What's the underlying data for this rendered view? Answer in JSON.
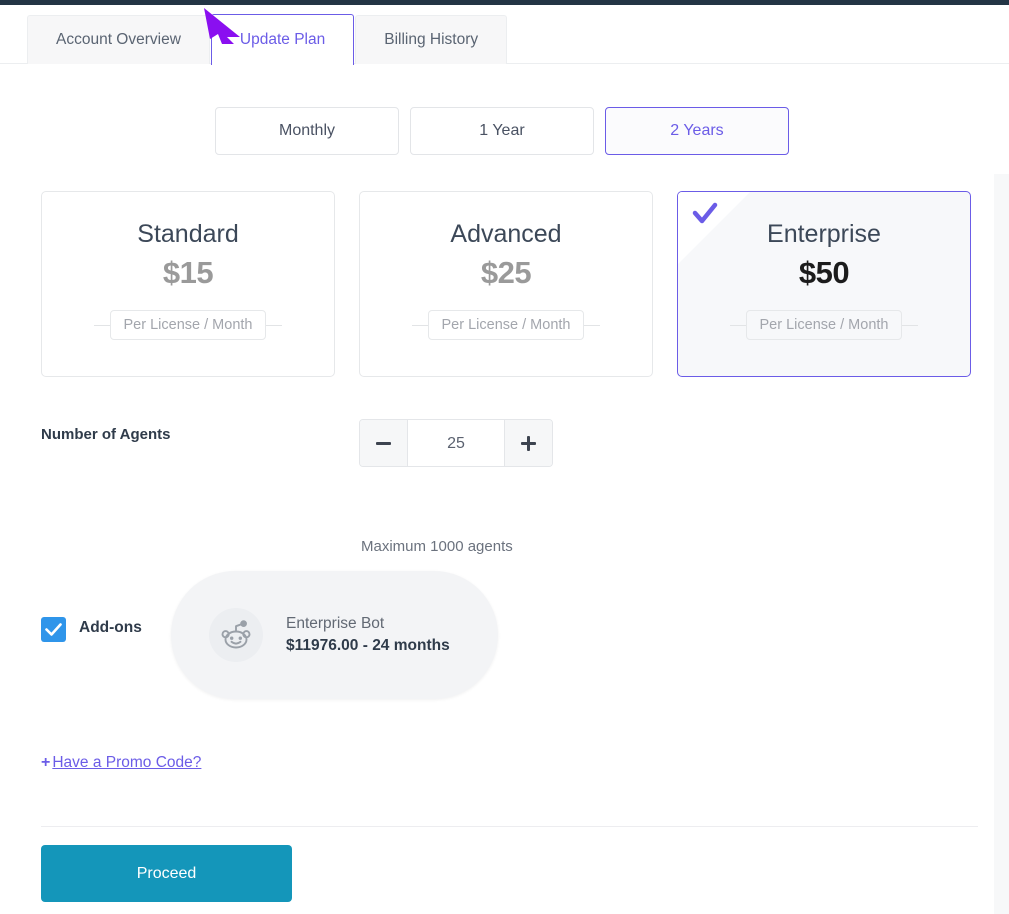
{
  "tabs": [
    {
      "label": "Account Overview",
      "active": false
    },
    {
      "label": "Update Plan",
      "active": true
    },
    {
      "label": "Billing History",
      "active": false
    }
  ],
  "billing_cycles": [
    {
      "label": "Monthly",
      "active": false
    },
    {
      "label": "1 Year",
      "active": false
    },
    {
      "label": "2 Years",
      "active": true
    }
  ],
  "plans": [
    {
      "name": "Standard",
      "price": "$15",
      "meta": "Per License / Month",
      "selected": false
    },
    {
      "name": "Advanced",
      "price": "$25",
      "meta": "Per License / Month",
      "selected": false
    },
    {
      "name": "Enterprise",
      "price": "$50",
      "meta": "Per License / Month",
      "selected": true
    }
  ],
  "agents": {
    "label": "Number of Agents",
    "value": "25",
    "max_note": "Maximum 1000 agents",
    "decrement_label": "–",
    "increment_label": "+"
  },
  "addons": {
    "label": "Add-ons",
    "checked": true,
    "item": {
      "icon": "reddit-snoo-icon",
      "title": "Enterprise Bot",
      "price": "$11976.00 - 24 months"
    }
  },
  "promo": {
    "plus": "+",
    "label": "Have a Promo Code?"
  },
  "footer": {
    "proceed_label": "Proceed"
  },
  "colors": {
    "accent_purple": "#6b5ce7",
    "proceed_teal": "#1496ba",
    "checkbox_blue": "#2f95ea",
    "topbar_navy": "#233545",
    "pointer_purple": "#8a0ff0"
  }
}
